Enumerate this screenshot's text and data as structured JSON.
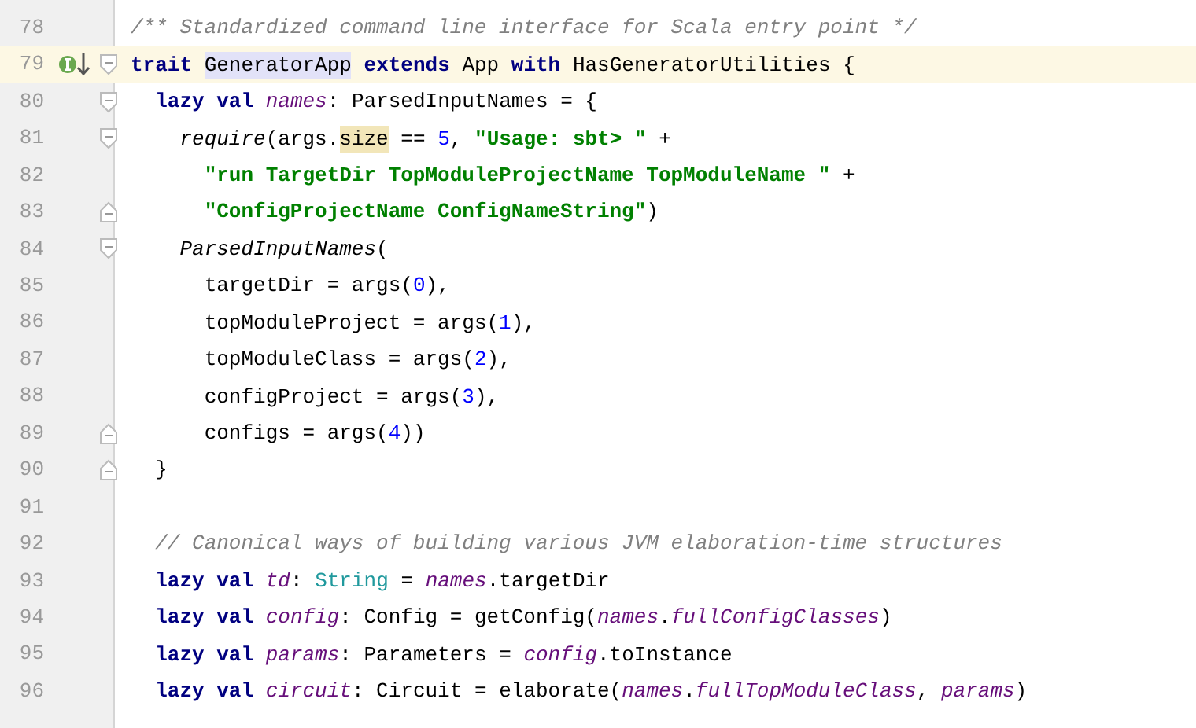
{
  "editor": {
    "lines": [
      {
        "number": "78",
        "current": false,
        "tokens": [
          {
            "kind": "comment",
            "text": "/** Standardized command line interface for Scala entry point */"
          }
        ]
      },
      {
        "number": "79",
        "current": true,
        "fold": {
          "kind": "start"
        },
        "marker": {
          "kind": "implements"
        },
        "tokens": [
          {
            "kind": "keyword",
            "text": "trait "
          },
          {
            "kind": "usage",
            "text": "GeneratorApp"
          },
          {
            "kind": "keyword",
            "text": " extends"
          },
          {
            "kind": "plain",
            "text": " App "
          },
          {
            "kind": "keyword",
            "text": "with"
          },
          {
            "kind": "plain",
            "text": " HasGeneratorUtilities {"
          }
        ]
      },
      {
        "number": "80",
        "current": false,
        "fold": {
          "kind": "start"
        },
        "tokens": [
          {
            "kind": "keyword",
            "text": "  lazy val "
          },
          {
            "kind": "field",
            "text": "names"
          },
          {
            "kind": "plain",
            "text": ": ParsedInputNames = {"
          }
        ]
      },
      {
        "number": "81",
        "current": false,
        "fold": {
          "kind": "start"
        },
        "tokens": [
          {
            "kind": "call",
            "text": "    require"
          },
          {
            "kind": "plain",
            "text": "(args."
          },
          {
            "kind": "match",
            "text": "size"
          },
          {
            "kind": "plain",
            "text": " == "
          },
          {
            "kind": "number",
            "text": "5"
          },
          {
            "kind": "plain",
            "text": ", "
          },
          {
            "kind": "string",
            "text": "\"Usage: sbt> \""
          },
          {
            "kind": "plain",
            "text": " +"
          }
        ]
      },
      {
        "number": "82",
        "current": false,
        "tokens": [
          {
            "kind": "string",
            "text": "      \"run TargetDir TopModuleProjectName TopModuleName \""
          },
          {
            "kind": "plain",
            "text": " +"
          }
        ]
      },
      {
        "number": "83",
        "current": false,
        "fold": {
          "kind": "end"
        },
        "tokens": [
          {
            "kind": "string",
            "text": "      \"ConfigProjectName ConfigNameString\""
          },
          {
            "kind": "plain",
            "text": ")"
          }
        ]
      },
      {
        "number": "84",
        "current": false,
        "fold": {
          "kind": "start"
        },
        "tokens": [
          {
            "kind": "call",
            "text": "    ParsedInputNames"
          },
          {
            "kind": "plain",
            "text": "("
          }
        ]
      },
      {
        "number": "85",
        "current": false,
        "tokens": [
          {
            "kind": "plain",
            "text": "      targetDir = args("
          },
          {
            "kind": "number",
            "text": "0"
          },
          {
            "kind": "plain",
            "text": "),"
          }
        ]
      },
      {
        "number": "86",
        "current": false,
        "tokens": [
          {
            "kind": "plain",
            "text": "      topModuleProject = args("
          },
          {
            "kind": "number",
            "text": "1"
          },
          {
            "kind": "plain",
            "text": "),"
          }
        ]
      },
      {
        "number": "87",
        "current": false,
        "tokens": [
          {
            "kind": "plain",
            "text": "      topModuleClass = args("
          },
          {
            "kind": "number",
            "text": "2"
          },
          {
            "kind": "plain",
            "text": "),"
          }
        ]
      },
      {
        "number": "88",
        "current": false,
        "tokens": [
          {
            "kind": "plain",
            "text": "      configProject = args("
          },
          {
            "kind": "number",
            "text": "3"
          },
          {
            "kind": "plain",
            "text": "),"
          }
        ]
      },
      {
        "number": "89",
        "current": false,
        "fold": {
          "kind": "end"
        },
        "tokens": [
          {
            "kind": "plain",
            "text": "      configs = args("
          },
          {
            "kind": "number",
            "text": "4"
          },
          {
            "kind": "plain",
            "text": "))"
          }
        ]
      },
      {
        "number": "90",
        "current": false,
        "fold": {
          "kind": "end"
        },
        "tokens": [
          {
            "kind": "plain",
            "text": "  }"
          }
        ]
      },
      {
        "number": "91",
        "current": false
      },
      {
        "number": "92",
        "current": false,
        "tokens": [
          {
            "kind": "comment",
            "text": "  // Canonical ways of building various JVM elaboration-time structures"
          }
        ]
      },
      {
        "number": "93",
        "current": false,
        "tokens": [
          {
            "kind": "keyword",
            "text": "  lazy val "
          },
          {
            "kind": "field",
            "text": "td"
          },
          {
            "kind": "plain",
            "text": ": "
          },
          {
            "kind": "type",
            "text": "String"
          },
          {
            "kind": "plain",
            "text": " = "
          },
          {
            "kind": "field",
            "text": "names"
          },
          {
            "kind": "plain",
            "text": ".targetDir"
          }
        ]
      },
      {
        "number": "94",
        "current": false,
        "tokens": [
          {
            "kind": "keyword",
            "text": "  lazy val "
          },
          {
            "kind": "field",
            "text": "config"
          },
          {
            "kind": "plain",
            "text": ": Config = getConfig("
          },
          {
            "kind": "field",
            "text": "names"
          },
          {
            "kind": "plain",
            "text": "."
          },
          {
            "kind": "field",
            "text": "fullConfigClasses"
          },
          {
            "kind": "plain",
            "text": ")"
          }
        ]
      },
      {
        "number": "95",
        "current": false,
        "tokens": [
          {
            "kind": "keyword",
            "text": "  lazy val "
          },
          {
            "kind": "field",
            "text": "params"
          },
          {
            "kind": "plain",
            "text": ": Parameters = "
          },
          {
            "kind": "field",
            "text": "config"
          },
          {
            "kind": "plain",
            "text": ".toInstance"
          }
        ]
      },
      {
        "number": "96",
        "current": false,
        "tokens": [
          {
            "kind": "keyword",
            "text": "  lazy val "
          },
          {
            "kind": "field",
            "text": "circuit"
          },
          {
            "kind": "plain",
            "text": ": Circuit = elaborate("
          },
          {
            "kind": "field",
            "text": "names"
          },
          {
            "kind": "plain",
            "text": "."
          },
          {
            "kind": "field",
            "text": "fullTopModuleClass"
          },
          {
            "kind": "plain",
            "text": ", "
          },
          {
            "kind": "field",
            "text": "params"
          },
          {
            "kind": "plain",
            "text": ")"
          }
        ]
      }
    ]
  }
}
